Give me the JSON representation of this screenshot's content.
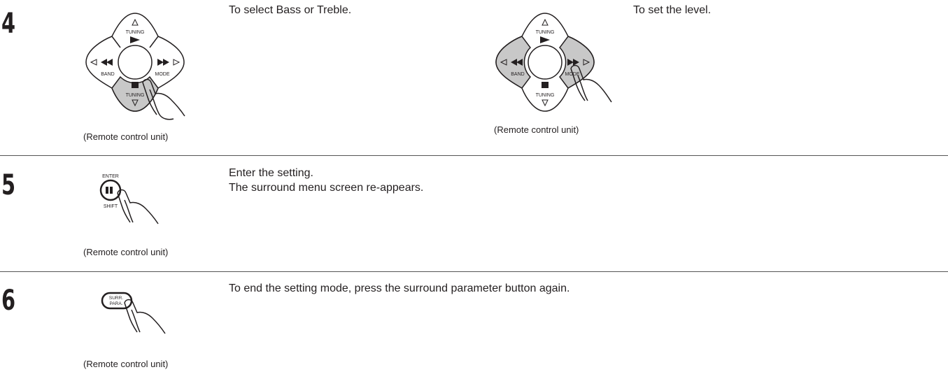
{
  "steps": [
    {
      "number": "4",
      "left_text": "To select Bass or Treble.",
      "left_caption": "(Remote control unit)",
      "right_text": "To set the level.",
      "right_caption": "(Remote control unit)"
    },
    {
      "number": "5",
      "text_line1": "Enter the setting.",
      "text_line2": "The surround menu screen re-appears.",
      "caption": "(Remote control unit)"
    },
    {
      "number": "6",
      "text": "To end the setting mode, press the surround parameter button again.",
      "caption": "(Remote control unit)"
    }
  ],
  "remote": {
    "up_label": "TUNING",
    "down_label": "TUNING",
    "left_label": "BAND",
    "right_label": "MODE",
    "enter_label": "ENTER",
    "shift_label": "SHIFT",
    "surr_line1": "SURR.",
    "surr_line2": "PARA."
  },
  "colors": {
    "highlight": "#c8c8c8",
    "ink": "#231f20"
  }
}
